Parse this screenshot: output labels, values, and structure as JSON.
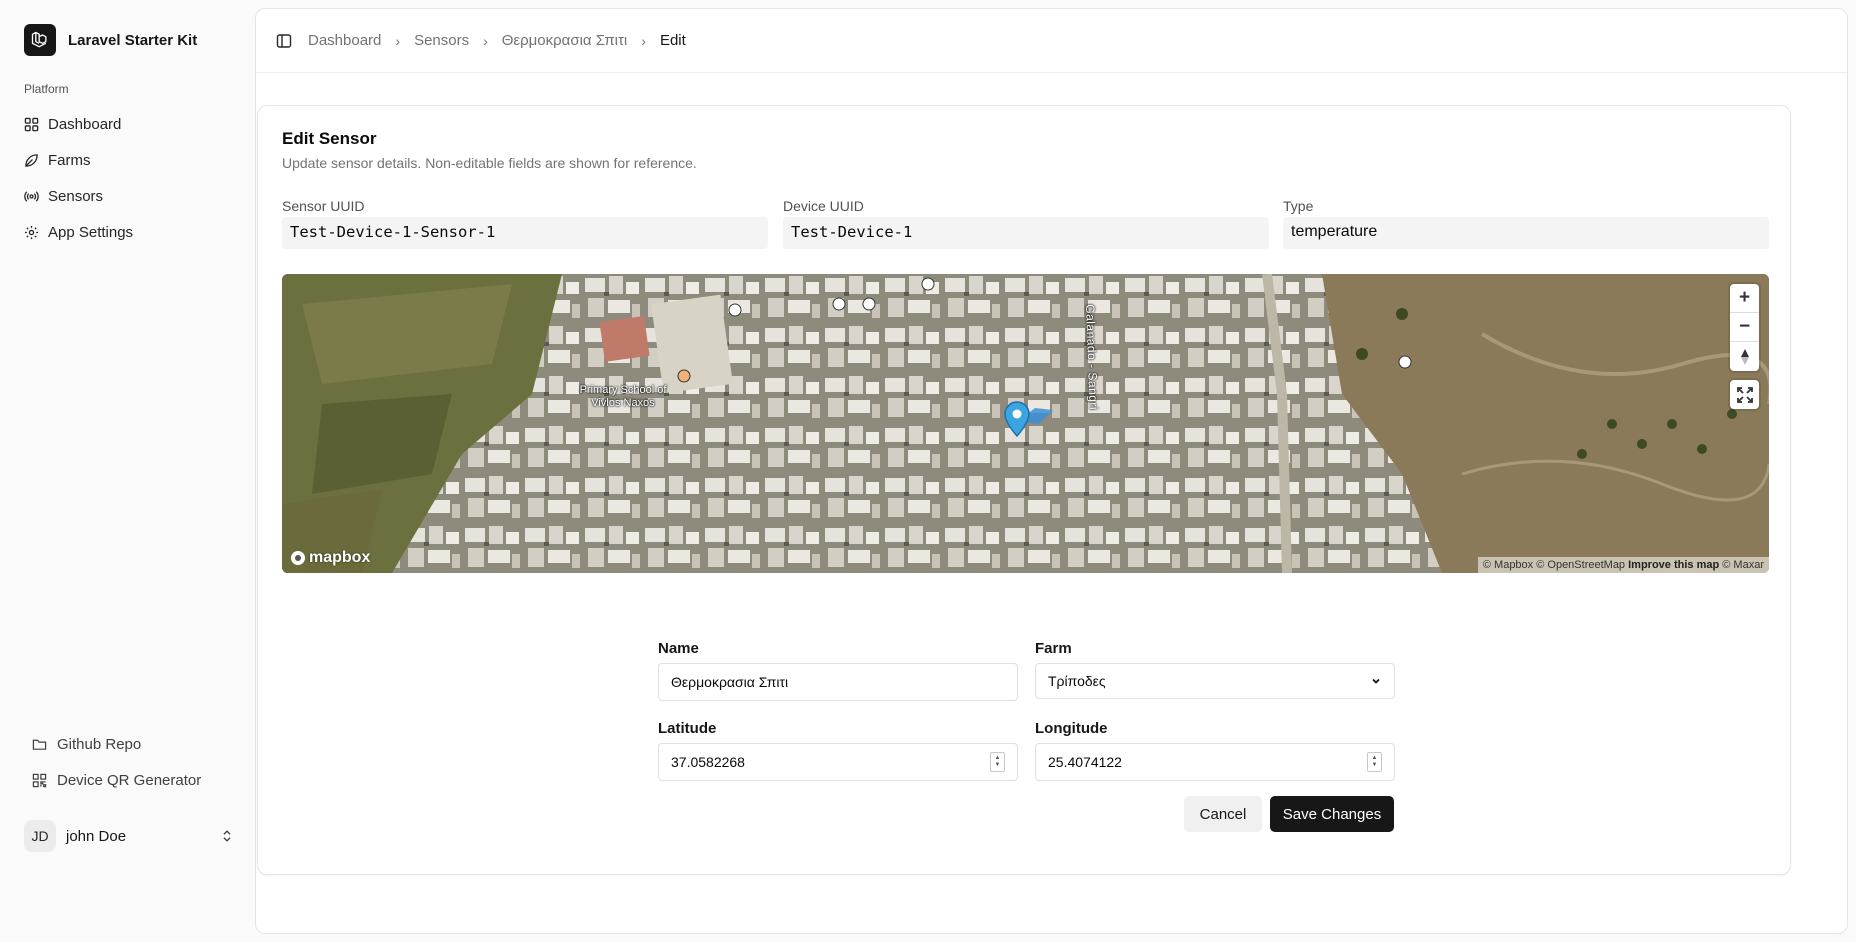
{
  "app": {
    "name": "Laravel Starter Kit"
  },
  "sidebar": {
    "group_label": "Platform",
    "items": [
      {
        "label": "Dashboard",
        "icon": "grid-icon"
      },
      {
        "label": "Farms",
        "icon": "leaf-icon"
      },
      {
        "label": "Sensors",
        "icon": "signal-icon"
      },
      {
        "label": "App Settings",
        "icon": "gear-icon"
      }
    ],
    "footer_links": [
      {
        "label": "Github Repo",
        "icon": "folder-icon"
      },
      {
        "label": "Device QR Generator",
        "icon": "qr-icon"
      }
    ],
    "user": {
      "initials": "JD",
      "name": "john Doe"
    }
  },
  "breadcrumb": [
    "Dashboard",
    "Sensors",
    "Θερμοκρασια Σπιτι",
    "Edit"
  ],
  "card": {
    "title": "Edit Sensor",
    "description": "Update sensor details. Non-editable fields are shown for reference."
  },
  "readonly_fields": {
    "sensor_uuid": {
      "label": "Sensor UUID",
      "value": "Test-Device-1-Sensor-1"
    },
    "device_uuid": {
      "label": "Device UUID",
      "value": "Test-Device-1"
    },
    "type": {
      "label": "Type",
      "value": "temperature"
    }
  },
  "map": {
    "school_label": "Primary School of Vivlos Naxos",
    "road_label": "Galanado - Sangri",
    "logo": "mapbox",
    "attribution": {
      "mapbox": "© Mapbox",
      "osm": "© OpenStreetMap",
      "improve": "Improve this map",
      "maxar": "© Maxar"
    },
    "zoom_in": "+",
    "zoom_out": "−"
  },
  "form": {
    "name": {
      "label": "Name",
      "value": "Θερμοκρασια Σπιτι"
    },
    "farm": {
      "label": "Farm",
      "value": "Τρίποδες"
    },
    "latitude": {
      "label": "Latitude",
      "value": "37.0582268"
    },
    "longitude": {
      "label": "Longitude",
      "value": "25.4074122"
    }
  },
  "buttons": {
    "cancel": "Cancel",
    "save": "Save Changes"
  },
  "colors": {
    "primary": "#171717",
    "muted_bg": "#f4f4f5",
    "border": "#e5e5e5"
  }
}
